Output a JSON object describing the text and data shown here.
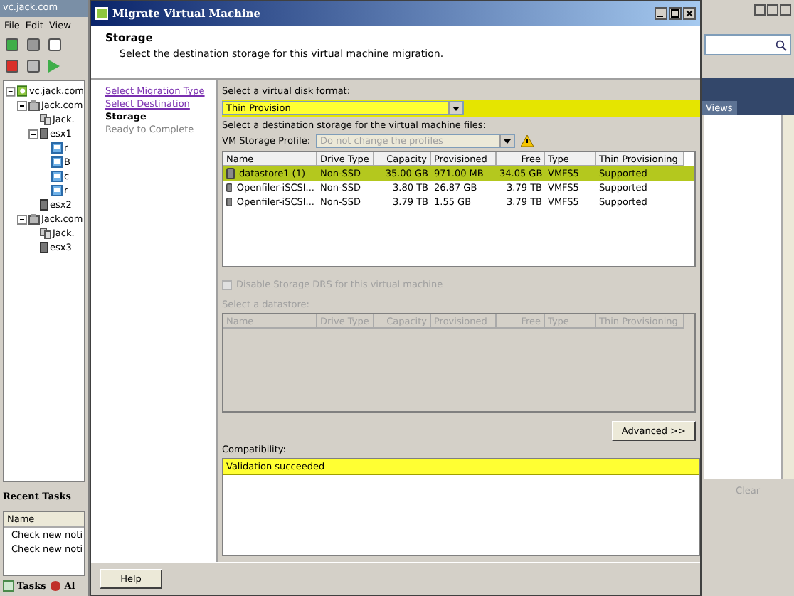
{
  "background_app": {
    "title": "vc.jack.com",
    "menu": [
      "File",
      "Edit",
      "View"
    ],
    "tree": [
      {
        "label": "vc.jack.com",
        "kind": "vcenter",
        "expanded": true,
        "children": [
          {
            "label": "Jack.com",
            "kind": "datacenter",
            "expanded": true,
            "children": [
              {
                "label": "Jack.",
                "kind": "cluster"
              },
              {
                "label": "esx1",
                "kind": "host",
                "expanded": true,
                "children": [
                  {
                    "label": "r",
                    "kind": "vm"
                  },
                  {
                    "label": "B",
                    "kind": "vm"
                  },
                  {
                    "label": "c",
                    "kind": "vm"
                  },
                  {
                    "label": "r",
                    "kind": "vm"
                  }
                ]
              },
              {
                "label": "esx2",
                "kind": "host"
              }
            ]
          },
          {
            "label": "Jack.com",
            "kind": "datacenter",
            "expanded": true,
            "children": [
              {
                "label": "Jack.",
                "kind": "cluster"
              },
              {
                "label": "esx3",
                "kind": "host"
              }
            ]
          }
        ]
      }
    ],
    "recent_tasks": {
      "title": "Recent Tasks",
      "column": "Name",
      "rows": [
        "Check new noti",
        "Check new noti"
      ]
    },
    "bottom_tabs": [
      "Tasks",
      "Al"
    ]
  },
  "right_panel": {
    "tab": "Views",
    "clear": "Clear"
  },
  "dialog": {
    "title": "Migrate Virtual Machine",
    "heading": "Storage",
    "subtitle": "Select the destination storage for this virtual machine migration.",
    "steps": [
      {
        "label": "Select Migration Type",
        "visited": true,
        "current": false
      },
      {
        "label": "Select Destination",
        "visited": true,
        "current": false
      },
      {
        "label": "Storage",
        "visited": false,
        "current": true
      },
      {
        "label": "Ready to Complete",
        "visited": false,
        "current": false
      }
    ],
    "disk_format_label": "Select a virtual disk format:",
    "disk_format": "Thin Provision",
    "destination_label": "Select a destination storage for the virtual machine files:",
    "profile_label": "VM Storage Profile:",
    "profile_value": "Do not change the profiles",
    "columns": [
      "Name",
      "Drive Type",
      "Capacity",
      "Provisioned",
      "Free",
      "Type",
      "Thin Provisioning"
    ],
    "rows": [
      {
        "cells": [
          "datastore1 (1)",
          "Non-SSD",
          "35.00 GB",
          "971.00 MB",
          "34.05 GB",
          "VMFS5",
          "Supported"
        ],
        "selected": true
      },
      {
        "cells": [
          "Openfiler-iSCSI...",
          "Non-SSD",
          "3.80 TB",
          "26.87 GB",
          "3.79 TB",
          "VMFS5",
          "Supported"
        ],
        "selected": false
      },
      {
        "cells": [
          "Openfiler-iSCSI...",
          "Non-SSD",
          "3.79 TB",
          "1.55 GB",
          "3.79 TB",
          "VMFS5",
          "Supported"
        ],
        "selected": false
      }
    ],
    "drs_checkbox": {
      "label": "Disable Storage DRS for this virtual machine",
      "checked": false,
      "disabled": true
    },
    "datastore_label": "Select a datastore:",
    "datastore_columns": [
      "Name",
      "Drive Type",
      "Capacity",
      "Provisioned",
      "Free",
      "Type",
      "Thin Provisioning"
    ],
    "advanced_button": "Advanced >>",
    "compatibility_label": "Compatibility:",
    "compatibility": [
      "Validation succeeded"
    ],
    "help_button": "Help"
  }
}
